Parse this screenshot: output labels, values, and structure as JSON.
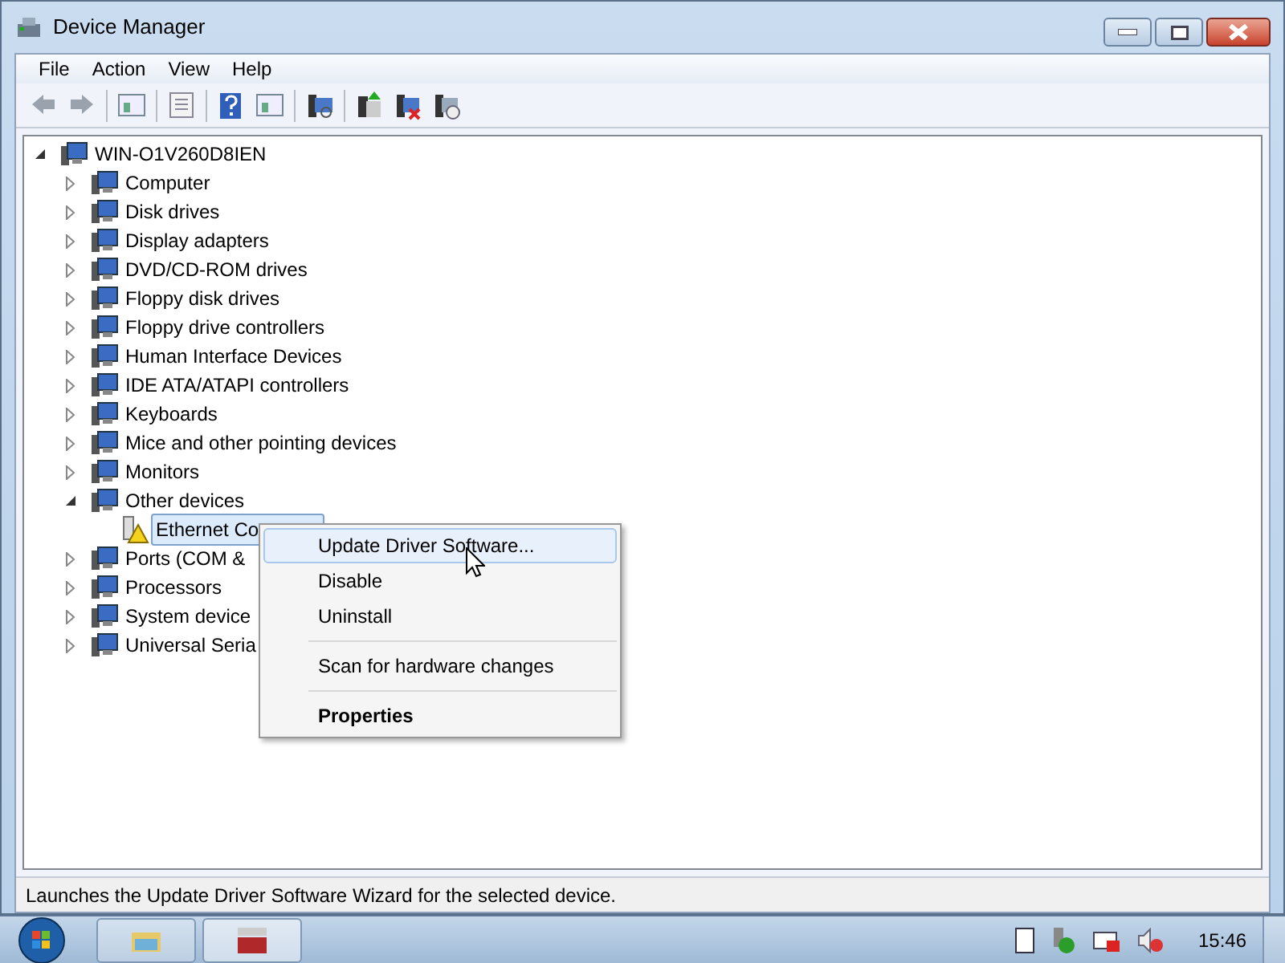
{
  "window": {
    "title": "Device Manager"
  },
  "menu_bar": [
    "File",
    "Action",
    "View",
    "Help"
  ],
  "tree": {
    "label": "WIN-O1V260D8IEN",
    "expanded": true,
    "children": [
      {
        "label": "Computer",
        "expanded": false
      },
      {
        "label": "Disk drives",
        "expanded": false
      },
      {
        "label": "Display adapters",
        "expanded": false
      },
      {
        "label": "DVD/CD-ROM drives",
        "expanded": false
      },
      {
        "label": "Floppy disk drives",
        "expanded": false
      },
      {
        "label": "Floppy drive controllers",
        "expanded": false
      },
      {
        "label": "Human Interface Devices",
        "expanded": false
      },
      {
        "label": "IDE ATA/ATAPI controllers",
        "expanded": false
      },
      {
        "label": "Keyboards",
        "expanded": false
      },
      {
        "label": "Mice and other pointing devices",
        "expanded": false
      },
      {
        "label": "Monitors",
        "expanded": false
      },
      {
        "label": "Other devices",
        "expanded": true,
        "children": [
          {
            "label": "Ethernet Co",
            "selected": true,
            "warning": true
          }
        ]
      },
      {
        "label": "Ports (COM &",
        "expanded": false
      },
      {
        "label": "Processors",
        "expanded": false
      },
      {
        "label": "System device",
        "expanded": false
      },
      {
        "label": "Universal Seria",
        "expanded": false
      }
    ]
  },
  "context_menu": [
    {
      "kind": "item",
      "label": "Update Driver Software...",
      "selected": true,
      "bold": false
    },
    {
      "kind": "item",
      "label": "Disable",
      "selected": false,
      "bold": false
    },
    {
      "kind": "item",
      "label": "Uninstall",
      "selected": false,
      "bold": false
    },
    {
      "kind": "separator"
    },
    {
      "kind": "item",
      "label": "Scan for hardware changes",
      "selected": false,
      "bold": false
    },
    {
      "kind": "separator"
    },
    {
      "kind": "item",
      "label": "Properties",
      "selected": false,
      "bold": true
    }
  ],
  "status_bar": "Launches the Update Driver Software Wizard for the selected device.",
  "taskbar": {
    "clock": "15:46"
  }
}
